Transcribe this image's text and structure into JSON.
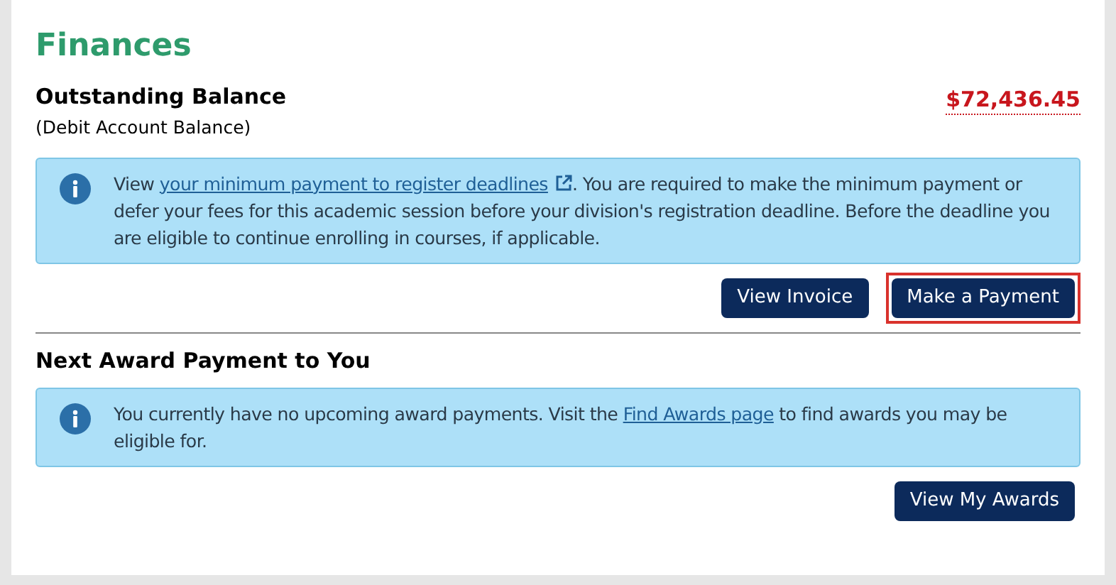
{
  "title": "Finances",
  "balance": {
    "label": "Outstanding Balance",
    "sublabel": "(Debit Account Balance)",
    "amount": "$72,436.45"
  },
  "notice": {
    "before": "View ",
    "link": "your minimum payment to register deadlines",
    "link_external": true,
    "after": ". You are required to make the minimum payment or defer your fees for this academic session before your division's registration deadline. Before the deadline you are eligible to continue enrolling in courses, if applicable."
  },
  "buttons": [
    {
      "label": "View Invoice",
      "highlighted": false
    },
    {
      "label": "Make a Payment",
      "highlighted": true
    }
  ],
  "awards": {
    "title": "Next Award Payment to You",
    "notice": {
      "before": "You currently have no upcoming award payments. Visit the ",
      "link": "Find Awards page",
      "link_external": false,
      "after": " to find awards you may be eligible for."
    },
    "buttons": [
      {
        "label": "View My Awards",
        "highlighted": false
      }
    ]
  }
}
